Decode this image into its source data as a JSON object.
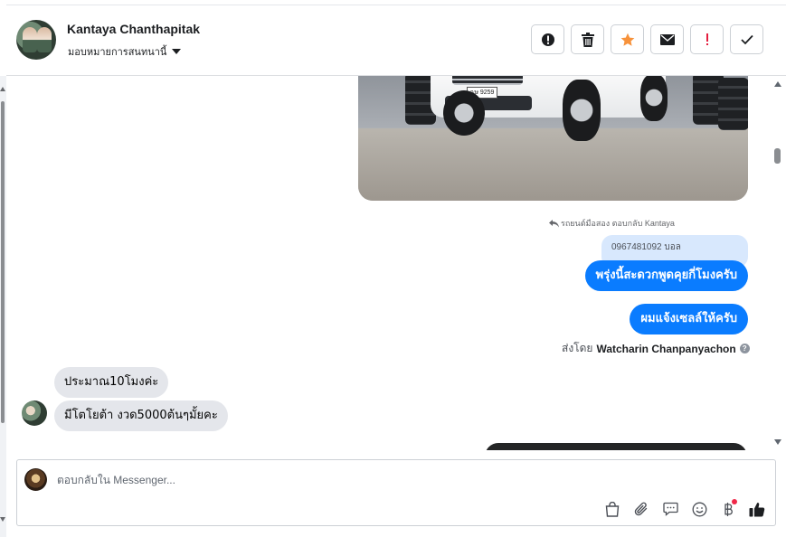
{
  "header": {
    "contact_name": "Kantaya Chanthapitak",
    "assign_label": "มอบหมายการสนทนานี้",
    "actions": [
      {
        "name": "spam-button",
        "icon": "alert-circle-icon"
      },
      {
        "name": "delete-button",
        "icon": "trash-icon"
      },
      {
        "name": "star-button",
        "icon": "star-icon"
      },
      {
        "name": "mark-unread-button",
        "icon": "envelope-icon"
      },
      {
        "name": "follow-up-button",
        "icon": "exclamation-icon"
      },
      {
        "name": "mark-done-button",
        "icon": "check-icon"
      }
    ]
  },
  "thread": {
    "photo": {
      "plate_text": "ฉษ 9259"
    },
    "reply_meta": "รถยนต์มือสอง ตอบกลับ Kantaya",
    "quoted_text": "0967481092 บอล",
    "outgoing": [
      {
        "text": "พรุ่งนี้สะดวกพูดคุยกี่โมงครับ"
      },
      {
        "text": "ผมแจ้งเซลล์ให้ครับ"
      }
    ],
    "sent_by_prefix": "ส่งโดย",
    "sent_by_name": "Watcharin Chanpanyachon",
    "incoming": [
      {
        "text": "ประมาณ10โมงค่ะ"
      },
      {
        "text": "มีโตโยต้า งวด5000ต้นๆมั้ยคะ"
      }
    ]
  },
  "composer": {
    "placeholder": "ตอบกลับใน Messenger...",
    "tools": [
      "bag-icon",
      "attachment-icon",
      "saved-reply-icon",
      "emoji-icon",
      "payment-icon",
      "like-icon"
    ]
  },
  "colors": {
    "accent": "#0a7cff",
    "quoted_bg": "#d8e8fd",
    "incoming_bg": "#e4e6eb",
    "star": "#f7923b",
    "follow_up": "#e41e3f"
  }
}
